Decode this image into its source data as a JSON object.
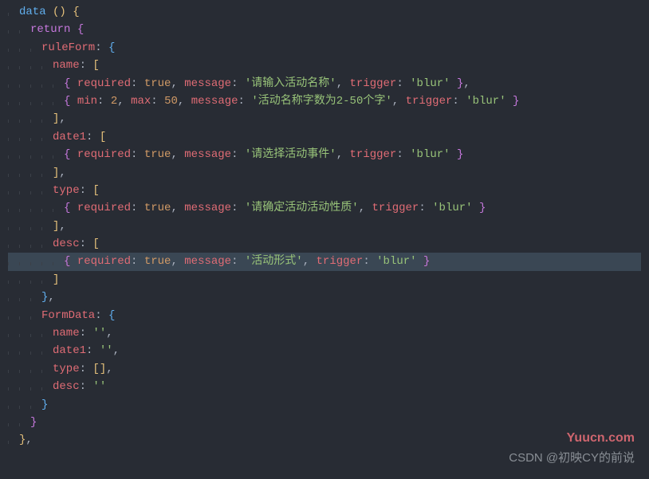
{
  "code": {
    "fn": "data",
    "ret": "return",
    "ruleForm": "ruleForm",
    "FormData": "FormData",
    "fields": {
      "name": "name",
      "date1": "date1",
      "type": "type",
      "desc": "desc"
    },
    "keys": {
      "required": "required",
      "message": "message",
      "trigger": "trigger",
      "min": "min",
      "max": "max"
    },
    "values": {
      "true": "true",
      "blur": "'blur'",
      "two": "2",
      "fifty": "50"
    },
    "strings": {
      "msg_name": "'请输入活动名称'",
      "msg_name_len": "'活动名称字数为2-50个字'",
      "msg_date": "'请选择活动事件'",
      "msg_type": "'请确定活动活动性质'",
      "msg_desc": "'活动形式'",
      "empty": "''",
      "emptyArr": "[]"
    }
  },
  "watermarks": {
    "wm1": "Yuucn.com",
    "wm2": "CSDN @初映CY的前说"
  }
}
